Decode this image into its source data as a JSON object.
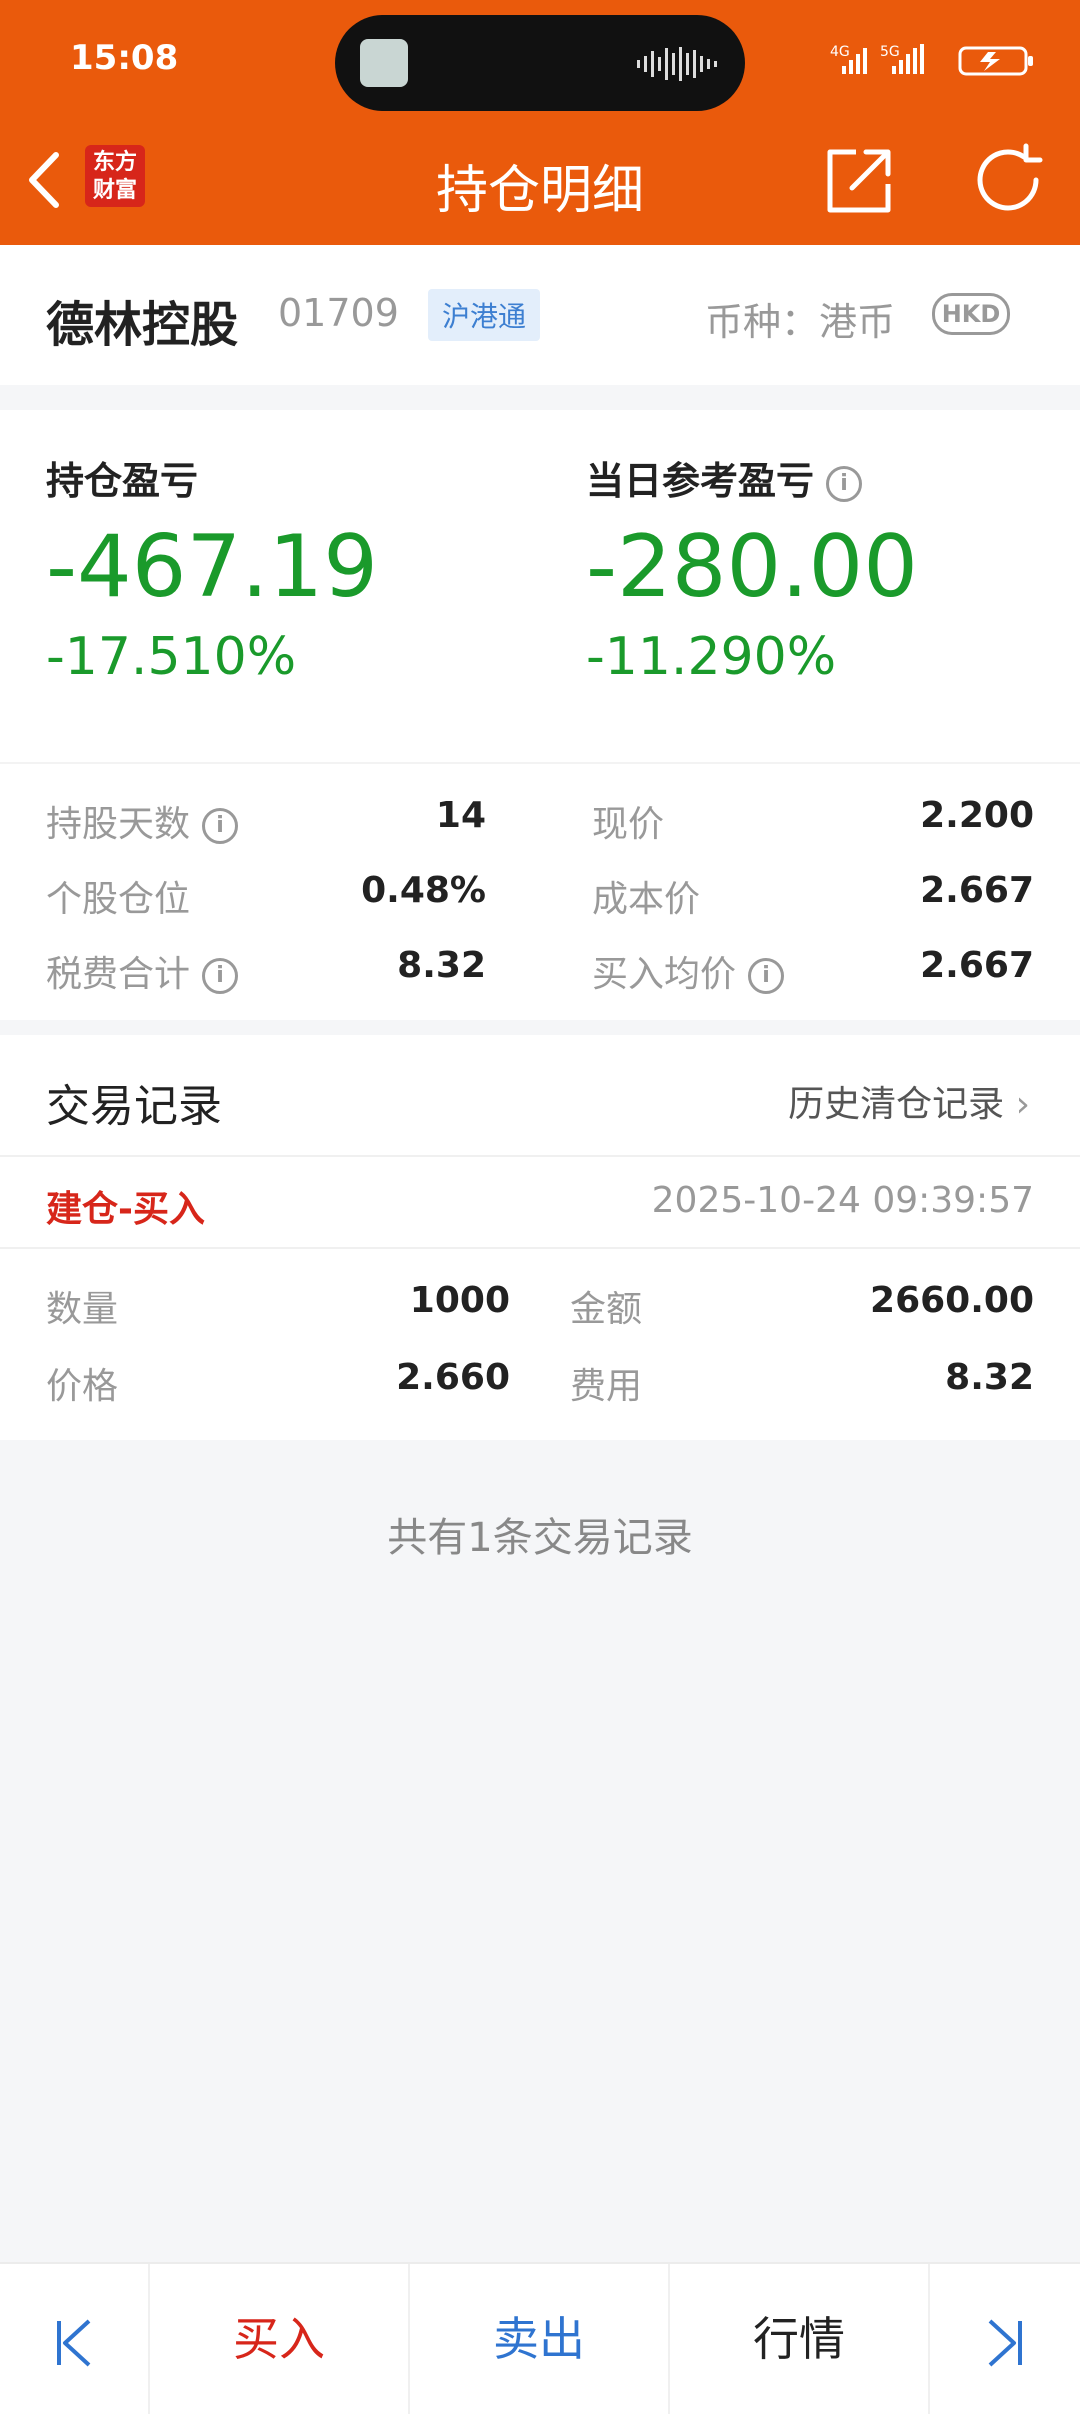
{
  "status": {
    "time": "15:08",
    "network": [
      "4G",
      "5G"
    ]
  },
  "header": {
    "logo_line1": "东方",
    "logo_line2": "财富",
    "title": "持仓明细"
  },
  "stock": {
    "name": "德林控股",
    "code": "01709",
    "tag": "沪港通",
    "currency_label": "币种：港币",
    "currency_badge": "HKD"
  },
  "pnl": {
    "hold_title": "持仓盈亏",
    "hold_value": "-467.19",
    "hold_pct": "-17.510%",
    "day_title": "当日参考盈亏",
    "day_value": "-280.00",
    "day_pct": "-11.290%"
  },
  "metrics": {
    "days_label": "持股天数",
    "days_value": "14",
    "position_label": "个股仓位",
    "position_value": "0.48%",
    "fees_label": "税费合计",
    "fees_value": "8.32",
    "price_label": "现价",
    "price_value": "2.200",
    "cost_label": "成本价",
    "cost_value": "2.667",
    "avg_label": "买入均价",
    "avg_value": "2.667"
  },
  "records": {
    "title": "交易记录",
    "history_link": "历史清仓记录",
    "trade": {
      "type": "建仓-买入",
      "time": "2025-10-24 09:39:57",
      "qty_label": "数量",
      "qty_value": "1000",
      "amount_label": "金额",
      "amount_value": "2660.00",
      "price_label": "价格",
      "price_value": "2.660",
      "fee_label": "费用",
      "fee_value": "8.32"
    },
    "summary": "共有1条交易记录"
  },
  "bottom": {
    "buy": "买入",
    "sell": "卖出",
    "market": "行情"
  },
  "colors": {
    "header": "#ea5a0c",
    "loss_green": "#1a9a2b",
    "buy_red": "#d7261a",
    "sell_blue": "#2f74d0"
  }
}
